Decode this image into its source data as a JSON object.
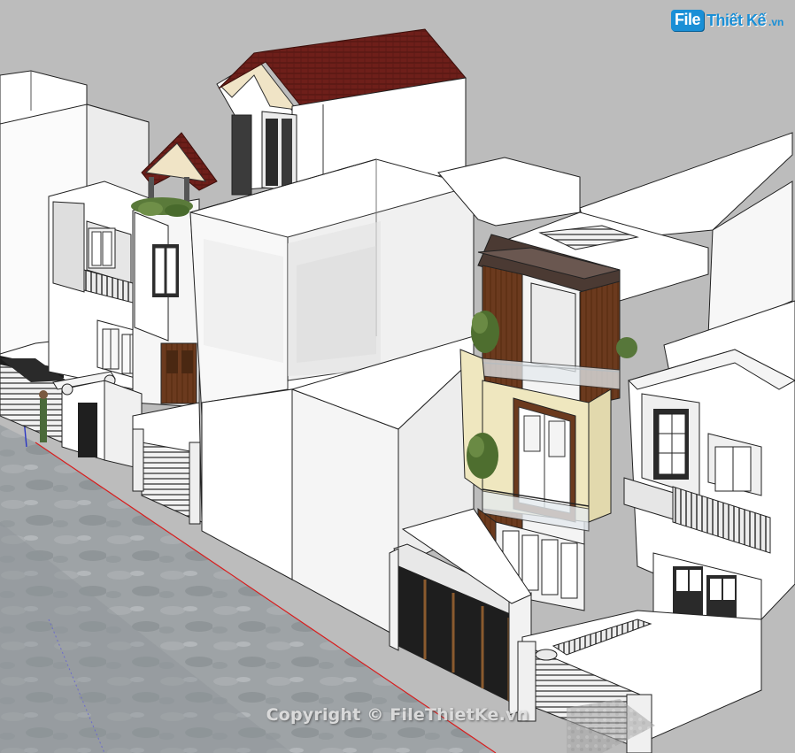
{
  "logo": {
    "badge": "File",
    "name": "Thiết Kế",
    "tld": ".vn"
  },
  "watermark": "Copyright © FileThietKe.vn",
  "colors": {
    "ground": "#bcbcbc",
    "road": "#9aa0a4",
    "roof": "#6e1f1a",
    "wood": "#6b3a1e",
    "cream": "#efe7bf",
    "axis_red": "#d81e1e",
    "axis_blue": "#2a36c4",
    "logo_blue": "#1a8fd6"
  }
}
